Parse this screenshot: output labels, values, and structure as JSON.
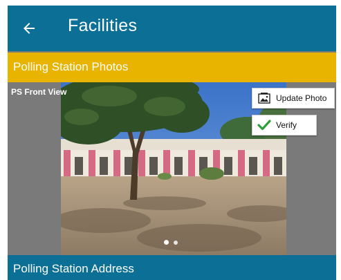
{
  "header": {
    "title": "Facilities",
    "back_icon": "arrow-left-icon"
  },
  "photos_section": {
    "title": "Polling Station Photos",
    "photo_caption": "PS Front View",
    "update_button_label": "Update Photo",
    "update_button_icon": "photo-icon",
    "verify_button_label": "Verify",
    "verify_button_icon": "checkmark-icon",
    "carousel": {
      "total": 2,
      "active_index": 0
    }
  },
  "address_section": {
    "title": "Polling Station Address"
  },
  "colors": {
    "appbar": "#0b6f96",
    "section_header": "#e9b400",
    "verify_check": "#2e9e3a"
  }
}
